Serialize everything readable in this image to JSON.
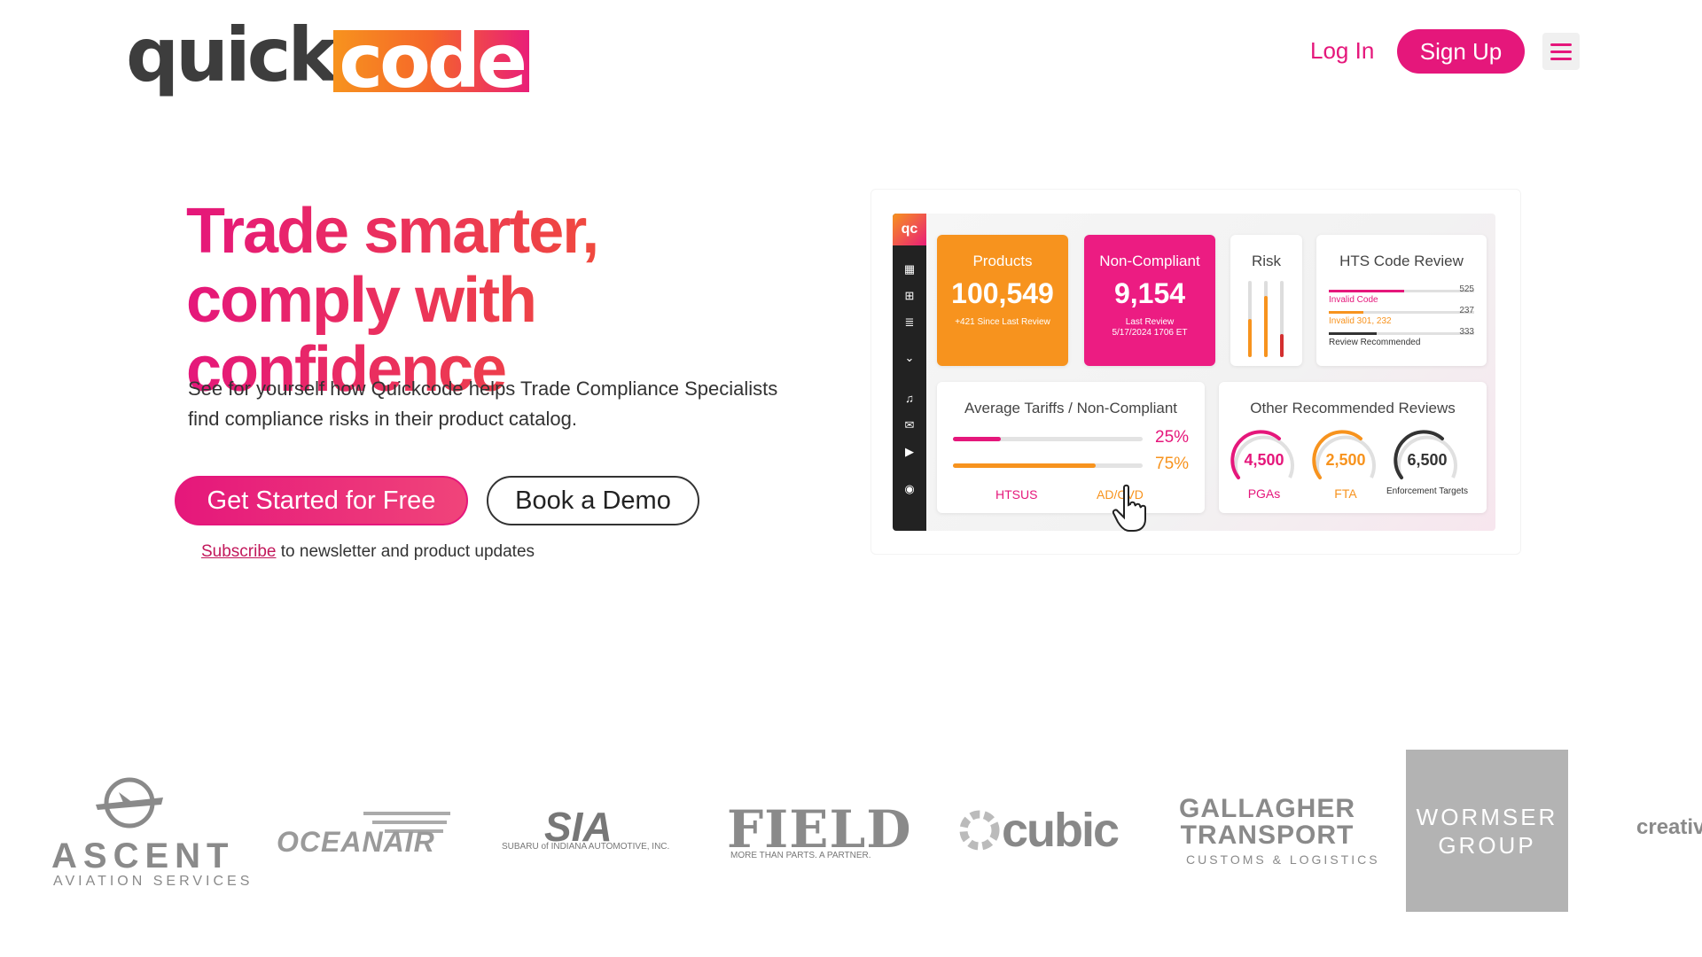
{
  "header": {
    "logo_quick": "quick",
    "logo_code": "code",
    "login_label": "Log In",
    "signup_label": "Sign Up",
    "menu_icon": "hamburger-icon"
  },
  "hero": {
    "title_line1": "Trade smarter,",
    "title_line2": "comply with confidence",
    "subtitle_line1": "See for yourself how Quickcode helps Trade Compliance Specialists",
    "subtitle_line2": "find compliance risks in their product catalog.",
    "cta_primary": "Get Started for Free",
    "cta_secondary": "Book a Demo",
    "subscribe_link": "Subscribe",
    "subscribe_text": " to newsletter and product updates"
  },
  "dashboard": {
    "brand": "qc",
    "products": {
      "label": "Products",
      "value": "100,549",
      "note": "+421 Since Last Review"
    },
    "noncompliant": {
      "label": "Non-Compliant",
      "value": "9,154",
      "note_line1": "Last Review",
      "note_line2": "5/17/2024 1706 ET"
    },
    "risk": {
      "label": "Risk",
      "levels": [
        0.5,
        0.8,
        0.3
      ]
    },
    "hts": {
      "label": "HTS Code Review",
      "rows": [
        {
          "name": "Invalid Code",
          "value": "525",
          "fill": 0.52,
          "color": "#e5177b"
        },
        {
          "name": "Invalid 301, 232",
          "value": "237",
          "fill": 0.24,
          "color": "#f7931e"
        },
        {
          "name": "Review Recommended",
          "value": "333",
          "fill": 0.33,
          "color": "#333333"
        }
      ]
    },
    "avg": {
      "label": "Average Tariffs / Non-Compliant",
      "rows": [
        {
          "pct": "25%",
          "fill": 0.25,
          "color": "#e5177b"
        },
        {
          "pct": "75%",
          "fill": 0.75,
          "color": "#f7931e"
        }
      ],
      "axis_htsus": "HTSUS",
      "axis_adcvd": "AD/CVD"
    },
    "other": {
      "label": "Other Recommended Reviews",
      "gauges": [
        {
          "value": "4,500",
          "name": "PGAs",
          "color": "#e5177b"
        },
        {
          "value": "2,500",
          "name": "FTA",
          "color": "#f7931e"
        },
        {
          "value": "6,500",
          "name": "Enforcement Targets",
          "color": "#333333"
        }
      ]
    }
  },
  "logos": {
    "ascent_name": "ASCENT",
    "ascent_sub": "AVIATION SERVICES",
    "oceanair": "OCEANAIR",
    "sia": "SIA",
    "sia_sub": "SUBARU of INDIANA AUTOMOTIVE, INC.",
    "field": "FIELD",
    "field_sub": "MORE THAN PARTS. A PARTNER.",
    "cubic": "cubic",
    "gallagher_line1": "GALLAGHER",
    "gallagher_line2": "TRANSPORT",
    "gallagher_sub": "CUSTOMS & LOGISTICS",
    "wormser_line1": "WORMSER",
    "wormser_line2": "GROUP",
    "creative": "creativ"
  },
  "colors": {
    "brand_pink": "#e5177b",
    "brand_orange": "#f7931e",
    "logo_gray": "#8a8a8a"
  }
}
